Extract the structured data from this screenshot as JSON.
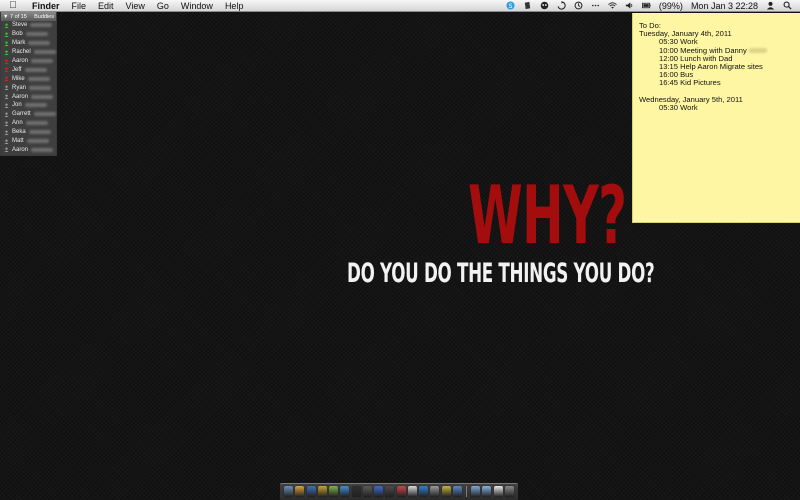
{
  "menubar": {
    "app_name": "Finder",
    "menus": [
      "File",
      "Edit",
      "View",
      "Go",
      "Window",
      "Help"
    ],
    "battery": "(99%)",
    "clock": "Mon Jan 3  22:28",
    "tray_icons": [
      "skype-icon",
      "evernote-icon",
      "growl-icon",
      "sync-icon",
      "time-machine-icon",
      "dots-icon",
      "wifi-icon",
      "volume-icon",
      "battery-icon"
    ]
  },
  "buddy_list": {
    "count": "7 of 15",
    "label": "Buddies",
    "buddies": [
      {
        "name": "Steve",
        "status": "online"
      },
      {
        "name": "Bob",
        "status": "online"
      },
      {
        "name": "Mark",
        "status": "online"
      },
      {
        "name": "Rachel",
        "status": "online"
      },
      {
        "name": "Aaron",
        "status": "away"
      },
      {
        "name": "Jeff",
        "status": "away"
      },
      {
        "name": "Mike",
        "status": "away"
      },
      {
        "name": "Ryan",
        "status": "offline"
      },
      {
        "name": "Aaron",
        "status": "offline"
      },
      {
        "name": "Jon",
        "status": "offline"
      },
      {
        "name": "Garrett",
        "status": "offline"
      },
      {
        "name": "Ann",
        "status": "offline"
      },
      {
        "name": "Beka",
        "status": "offline"
      },
      {
        "name": "Matt",
        "status": "offline"
      },
      {
        "name": "Aaron",
        "status": "offline"
      }
    ],
    "status_colors": {
      "online": "#2fcf2f",
      "away": "#e02020",
      "offline": "#9a9a9a"
    }
  },
  "sticky": {
    "title": "To Do:",
    "day1": "Tuesday, January 4th, 2011",
    "day1_items": [
      "05:30 Work",
      "10:00 Meeting with Danny",
      "12:00 Lunch with Dad",
      "13:15 Help Aaron Migrate sites",
      "16:00 Bus",
      "16:45 Kid Pictures"
    ],
    "day2": "Wednesday, January 5th, 2011",
    "day2_items": [
      "05:30 Work"
    ]
  },
  "wallpaper": {
    "headline": "WHY?",
    "subtitle": "DO YOU DO THE THINGS YOU DO?",
    "headline_color": "#a40d0d"
  },
  "dock": {
    "icon_colors": [
      "#6d8fb8",
      "#d9a23a",
      "#3c6fbf",
      "#c8a032",
      "#7fb24a",
      "#3f8fd6",
      "#2d2d2d",
      "#5a5a5a",
      "#3a6bd1",
      "#4a4a4a",
      "#c44",
      "#d8d8d8",
      "#2f7fd0",
      "#999",
      "#c6b23c",
      "#5b87c9",
      "#7ea8d8",
      "#88b0de",
      "#e9e9e9",
      "#8a8a8a"
    ]
  }
}
